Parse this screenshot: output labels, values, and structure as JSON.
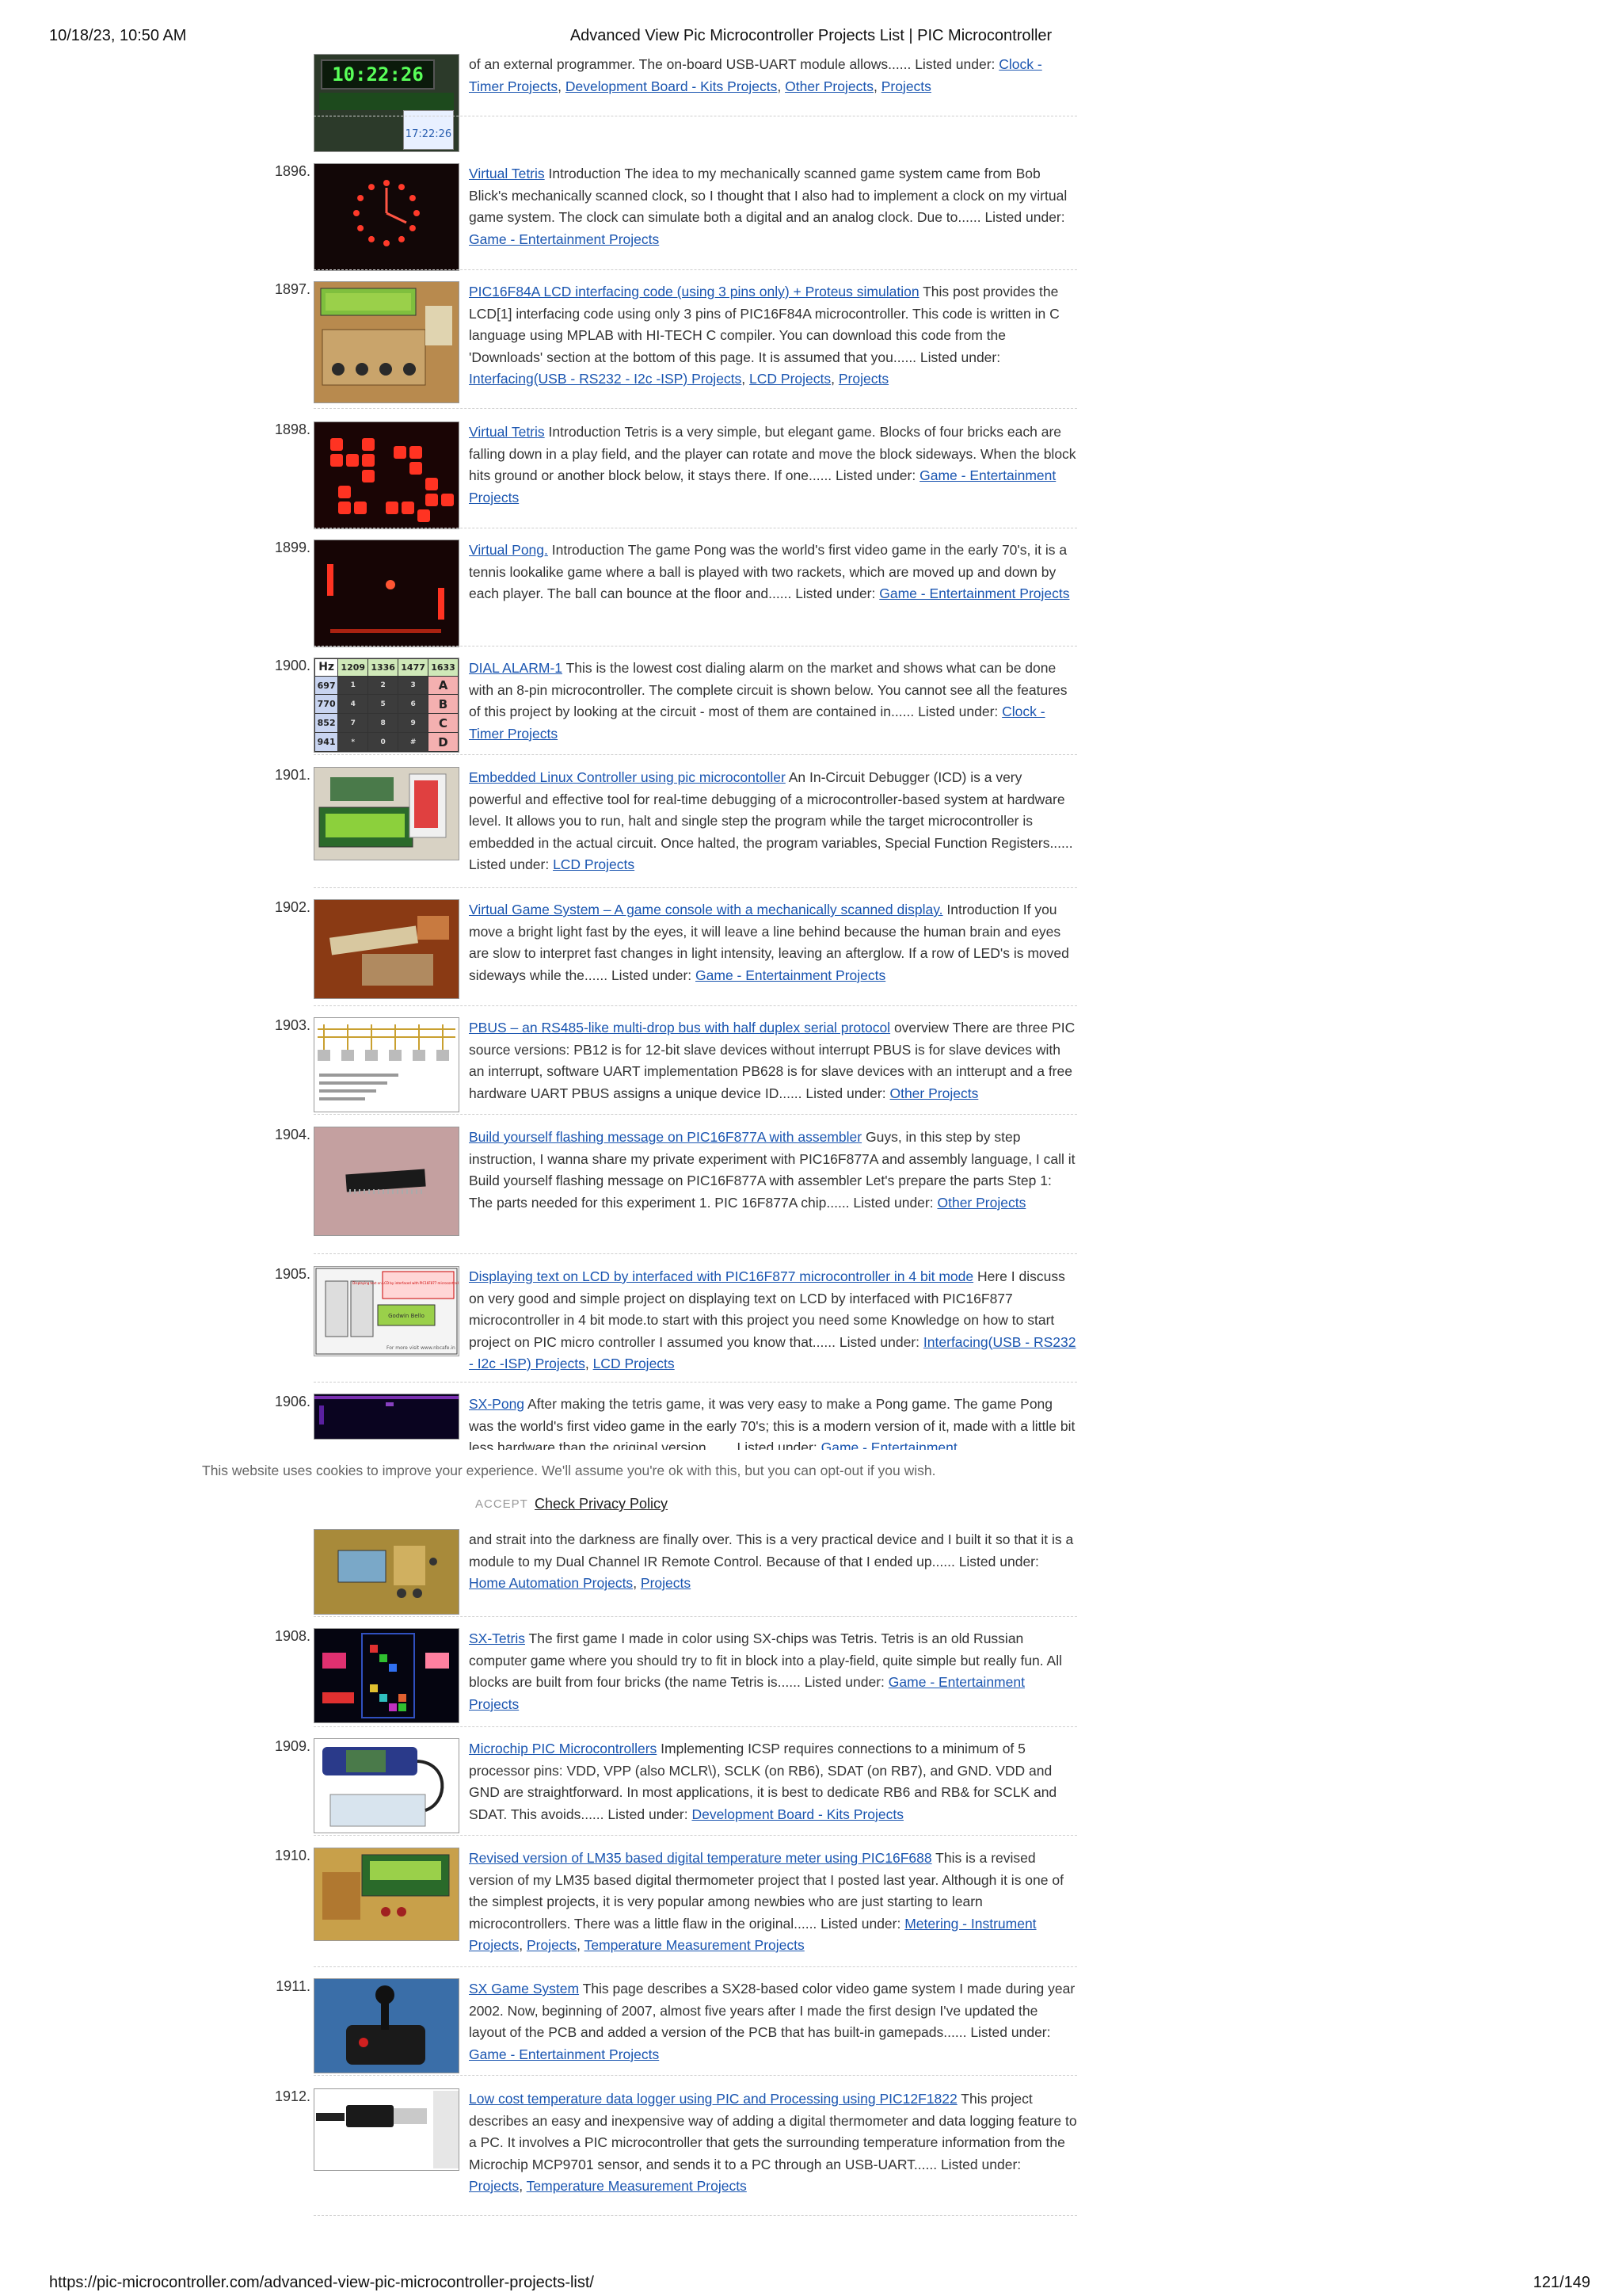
{
  "header": {
    "datetime": "10/18/23, 10:50 AM",
    "title": "Advanced View Pic Microcontroller Projects List | PIC Microcontroller"
  },
  "footer": {
    "url": "https://pic-microcontroller.com/advanced-view-pic-microcontroller-projects-list/",
    "page": "121/149"
  },
  "cookie": {
    "message": "This website uses cookies to improve your experience. We'll assume you're ok with this, but you can opt-out if you wish.",
    "accept": "ACCEPT",
    "policy": "Check Privacy Policy"
  },
  "thumb_texts": {
    "clock_display": "10:22:26",
    "clock_time": "17:22:26",
    "dtmf_hz": "Hz",
    "lcd_caption": "Displaying text on LCD by interfaced with PIC16F877 microcontroller in 4 bit mode",
    "lcd_screen": "Godwin Bello",
    "lcd_site": "For more visit www.nbcafe.in"
  },
  "entries": [
    {
      "num": "",
      "title": "",
      "desc": "of an external programmer. The on-board USB-UART module allows......",
      "listed": "Listed under:",
      "cats": [
        "Clock - Timer Projects",
        "Development Board - Kits Projects",
        "Other Projects",
        "Projects"
      ]
    },
    {
      "num": "1896.",
      "title": "Virtual Tetris",
      "desc": "Introduction The idea to my mechanically scanned game system came from Bob Blick's mechanically scanned clock, so I thought that I also had to implement a clock on my virtual game system. The clock can simulate both a digital and an analog clock. Due to......",
      "listed": "Listed under:",
      "cats": [
        "Game - Entertainment Projects"
      ]
    },
    {
      "num": "1897.",
      "title": "PIC16F84A LCD interfacing code (using 3 pins only) + Proteus simulation",
      "desc": "This post provides the LCD[1] interfacing code using only 3 pins of PIC16F84A microcontroller. This code is written in C language using MPLAB with HI-TECH C compiler. You can download this code from the 'Downloads' section at the bottom of this page. It is assumed that you......",
      "listed": "Listed under:",
      "cats": [
        "Interfacing(USB - RS232 - I2c -ISP) Projects",
        "LCD Projects",
        "Projects"
      ]
    },
    {
      "num": "1898.",
      "title": "Virtual Tetris",
      "desc": "Introduction Tetris is a very simple, but elegant game. Blocks of four bricks each are falling down in a play field, and the player can rotate and move the block sideways. When the block hits ground or another block below, it stays there. If one......",
      "listed": "Listed under:",
      "cats": [
        "Game - Entertainment Projects"
      ]
    },
    {
      "num": "1899.",
      "title": "Virtual Pong.",
      "desc": "Introduction The game Pong was the world's first video game in the early 70's, it is a tennis lookalike game where a ball is played with two rackets, which are moved up and down by each player. The ball can bounce at the floor and......",
      "listed": "Listed under:",
      "cats": [
        "Game - Entertainment Projects"
      ]
    },
    {
      "num": "1900.",
      "title": "DIAL ALARM-1",
      "desc": "This is the lowest cost dialing alarm on the market and shows what can be done with an 8-pin microcontroller. The complete circuit is shown below. You cannot see all the features of this project by looking at the circuit - most of them are contained in......",
      "listed": "Listed under:",
      "cats": [
        "Clock - Timer Projects"
      ]
    },
    {
      "num": "1901.",
      "title": "Embedded Linux Controller using pic microcontoller",
      "desc": "An In-Circuit Debugger (ICD) is a very powerful and effective tool for real-time debugging of a microcontroller-based system at hardware level. It allows you to run, halt and single step the program while the target microcontroller is embedded in the actual circuit. Once halted, the program variables, Special Function Registers......",
      "listed": "Listed under:",
      "cats": [
        "LCD Projects"
      ]
    },
    {
      "num": "1902.",
      "title": "Virtual Game System – A game console with a mechanically scanned display.",
      "desc": "Introduction If you move a bright light fast by the eyes, it will leave a line behind because the human brain and eyes are slow to interpret fast changes in light intensity, leaving an afterglow. If a row of LED's is moved sideways while the......",
      "listed": "Listed under:",
      "cats": [
        "Game - Entertainment Projects"
      ]
    },
    {
      "num": "1903.",
      "title": "PBUS – an RS485-like multi-drop bus with half duplex serial protocol",
      "desc": "overview There are three PIC source versions: PB12 is for 12-bit slave devices without interrupt PBUS is for slave devices with an interrupt, software UART implementation PB628 is for slave devices with an intterupt and a free hardware UART PBUS assigns a unique device ID......",
      "listed": "Listed under:",
      "cats": [
        "Other Projects"
      ]
    },
    {
      "num": "1904.",
      "title": "Build yourself flashing message on PIC16F877A with assembler",
      "desc": "Guys, in this step by step instruction, I wanna share my private experiment with PIC16F877A and assembly language, I call it Build yourself flashing message on PIC16F877A with assembler Let's prepare the parts Step 1: The parts needed for this experiment 1. PIC 16F877A chip......",
      "listed": "Listed under:",
      "cats": [
        "Other Projects"
      ]
    },
    {
      "num": "1905.",
      "title": "Displaying text on LCD by interfaced with PIC16F877 microcontroller in 4 bit mode",
      "desc": "Here I discuss on very good and simple project on displaying text on LCD by interfaced with PIC16F877 microcontroller in 4 bit mode.to start with this project you need some Knowledge on how to start project on PIC micro controller I assumed you know that......",
      "listed": "Listed under:",
      "cats": [
        "Interfacing(USB - RS232 - I2c -ISP) Projects",
        "LCD Projects"
      ]
    },
    {
      "num": "1906.",
      "title": "SX-Pong",
      "desc": "After making the tetris game, it was very easy to make a Pong game. The game Pong was the world's first video game in the early 70's; this is a modern version of it, made with a little bit less hardware than the original version.......",
      "listed": "Listed under:",
      "cats": [
        "Game - Entertainment"
      ]
    },
    {
      "num": "",
      "title": "",
      "desc": "and strait into the darkness are finally over. This is a very practical device and I built it so that it is a module to my Dual Channel IR Remote Control. Because of that I ended up......",
      "listed": "Listed under:",
      "cats": [
        "Home Automation Projects",
        "Projects"
      ]
    },
    {
      "num": "1908.",
      "title": "SX-Tetris",
      "desc": "The first game I made in color using SX-chips was Tetris. Tetris is an old Russian computer game where you should try to fit in block into a play-field, quite simple but really fun. All blocks are built from four bricks (the name Tetris is......",
      "listed": "Listed under:",
      "cats": [
        "Game - Entertainment Projects"
      ]
    },
    {
      "num": "1909.",
      "title": "Microchip PIC Microcontrollers",
      "desc": "Implementing ICSP requires connections to a minimum of 5 processor pins: VDD, VPP (also MCLR\\), SCLK (on RB6), SDAT (on RB7), and GND. VDD and GND are straightforward. In most applications, it is best to dedicate RB6 and RB& for SCLK and SDAT. This avoids......",
      "listed": "Listed under:",
      "cats": [
        "Development Board - Kits Projects"
      ]
    },
    {
      "num": "1910.",
      "title": "Revised version of LM35 based digital temperature meter using PIC16F688",
      "desc": "This is a revised version of my LM35 based digital thermometer project that I posted last year. Although it is one of the simplest projects, it is very popular among newbies who are just starting to learn microcontrollers. There was a little flaw in the original......",
      "listed": "Listed under:",
      "cats": [
        "Metering - Instrument Projects",
        "Projects",
        "Temperature Measurement Projects"
      ]
    },
    {
      "num": "1911.",
      "title": "SX Game System",
      "desc": "This page describes a SX28-based color video game system I made during year 2002. Now, beginning of 2007, almost five years after I made the first design I've updated the layout of the PCB and added a version of the PCB that has built-in gamepads......",
      "listed": "Listed under:",
      "cats": [
        "Game - Entertainment Projects"
      ]
    },
    {
      "num": "1912.",
      "title": "Low cost temperature data logger using PIC and Processing using PIC12F1822",
      "desc": "This project describes an easy and inexpensive way of adding a digital thermometer and data logging feature to a PC. It involves a PIC microcontroller that gets the surrounding temperature information from the Microchip MCP9701 sensor, and sends it to a PC through an USB-UART......",
      "listed": "Listed under:",
      "cats": [
        "Projects",
        "Temperature Measurement Projects"
      ]
    }
  ],
  "dtmf": {
    "cols": [
      "1209",
      "1336",
      "1477",
      "1633"
    ],
    "rows": [
      "697",
      "770",
      "852",
      "941"
    ],
    "keys": [
      [
        "1",
        "2",
        "3",
        "A"
      ],
      [
        "4",
        "5",
        "6",
        "B"
      ],
      [
        "7",
        "8",
        "9",
        "C"
      ],
      [
        "*",
        "0",
        "#",
        "D"
      ]
    ]
  }
}
